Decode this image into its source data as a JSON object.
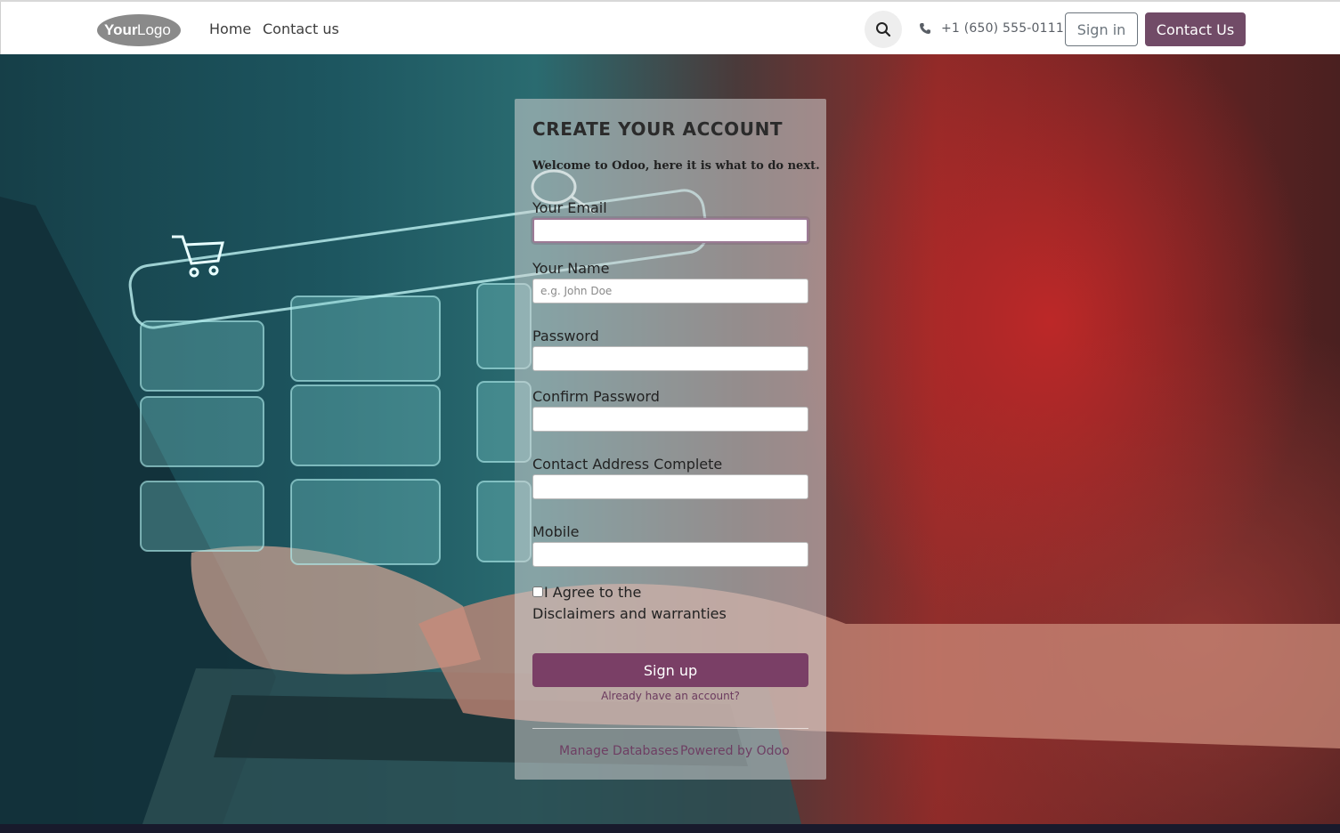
{
  "header": {
    "logo_text": "YourLogo",
    "nav": [
      {
        "label": "Home"
      },
      {
        "label": "Contact us"
      }
    ],
    "phone": "+1 (650) 555-0111",
    "signin_label": "Sign in",
    "contact_label": "Contact Us"
  },
  "form": {
    "title": "CREATE YOUR ACCOUNT",
    "welcome": "Welcome to Odoo, here it is what to do next.",
    "fields": [
      {
        "label": "Your Email",
        "value": "",
        "placeholder": ""
      },
      {
        "label": "Your Name",
        "value": "",
        "placeholder": "e.g. John Doe"
      },
      {
        "label": "Password",
        "value": "",
        "placeholder": ""
      },
      {
        "label": "Confirm Password",
        "value": "",
        "placeholder": ""
      },
      {
        "label": "Contact Address Complete",
        "value": "",
        "placeholder": ""
      },
      {
        "label": "Mobile",
        "value": "",
        "placeholder": ""
      }
    ],
    "agree_label": "I Agree to the",
    "disclaimer_label": "Disclaimers and warranties",
    "agree_checked": false,
    "signup_label": "Sign up",
    "already_label": "Already have an account?",
    "footer_links": [
      {
        "label": "Manage Databases"
      },
      {
        "label": "Powered by Odoo"
      }
    ]
  },
  "colors": {
    "brand": "#714b67",
    "signup_button": "#7a3f66"
  },
  "icons": [
    "search-icon",
    "phone-icon",
    "cart-icon",
    "magnifier-icon"
  ]
}
